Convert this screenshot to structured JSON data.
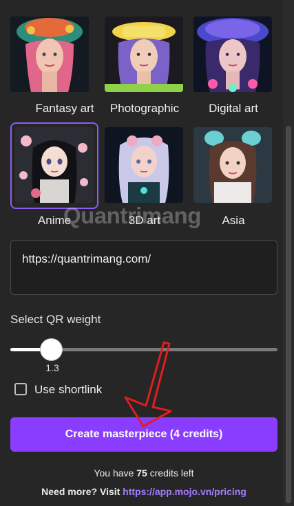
{
  "styles": [
    {
      "label": "Fantasy art"
    },
    {
      "label": "Photographic"
    },
    {
      "label": "Digital art"
    },
    {
      "label": "Anime"
    },
    {
      "label": "3D art"
    },
    {
      "label": "Asia"
    }
  ],
  "selected_style": "Anime",
  "url_input": {
    "value": "https://quantrimang.com/"
  },
  "qr_weight": {
    "label": "Select QR weight",
    "value": "1.3",
    "fraction": 0.155
  },
  "shortlink": {
    "label": "Use shortlink",
    "checked": false
  },
  "create_button": {
    "label": "Create masterpiece (4 credits)"
  },
  "credits": {
    "prefix": "You have",
    "count": "75",
    "suffix": "credits left"
  },
  "need_more": {
    "text": "Need more? Visit",
    "link": "https://app.mojo.vn/pricing"
  },
  "watermark": "Quantrimang",
  "colors": {
    "accent": "#8b3dff",
    "link": "#a57bff",
    "background": "#262627"
  }
}
